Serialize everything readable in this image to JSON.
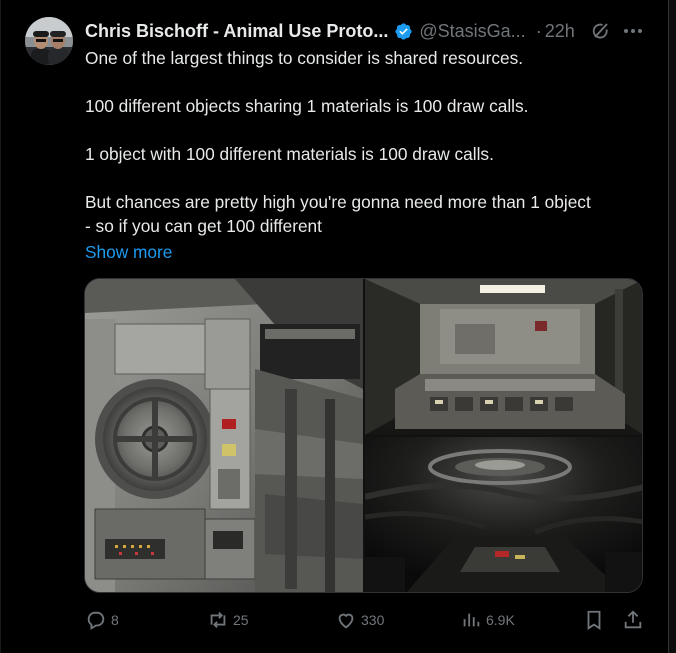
{
  "post": {
    "author_name": "Chris Bischoff - Animal Use Proto...",
    "handle": "@StasisGa...",
    "separator": "·",
    "time": "22h",
    "verified": true,
    "body_lines": [
      "One of the largest things to consider is shared resources.",
      "100 different objects sharing 1 materials is 100 draw calls.",
      "1 object with 100 different materials is 100 draw calls.",
      "But chances are pretty high you're gonna need more than 1 object",
      "- so if you can get 100 different"
    ],
    "show_more": "Show more"
  },
  "icons": {
    "verified": "verified-badge-icon",
    "grok": "grok-icon",
    "more": "more-options-icon",
    "reply": "reply-icon",
    "repost": "repost-icon",
    "like": "like-icon",
    "views": "views-icon",
    "bookmark": "bookmark-icon",
    "share": "share-icon"
  },
  "actions": {
    "replies": "8",
    "reposts": "25",
    "likes": "330",
    "views": "6.9K"
  },
  "colors": {
    "background": "#000000",
    "text": "#e7e9ea",
    "muted": "#71767b",
    "link": "#1d9bf0",
    "verified": "#1d9bf0",
    "border": "#2f3336"
  }
}
